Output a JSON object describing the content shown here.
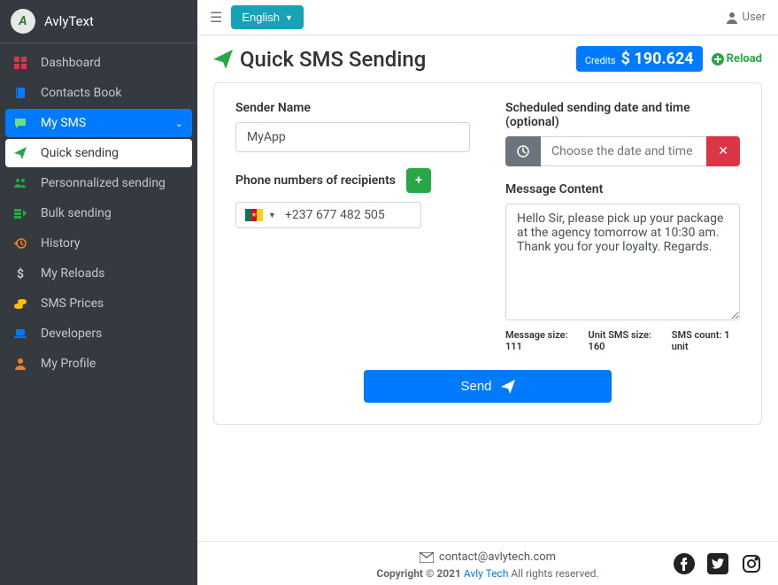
{
  "brand": {
    "name": "AvlyText",
    "logo_letter": "A"
  },
  "topbar": {
    "language": "English",
    "user_label": "User"
  },
  "sidebar": {
    "items": [
      {
        "label": "Dashboard",
        "icon": "grid",
        "color": "#dc3545"
      },
      {
        "label": "Contacts Book",
        "icon": "book",
        "color": "#007bff"
      },
      {
        "label": "My SMS",
        "icon": "comment",
        "color": "#71e07a",
        "active": true,
        "expandable": true
      },
      {
        "label": "Quick sending",
        "icon": "plane",
        "color": "#28a745",
        "sub": true
      },
      {
        "label": "Personnalized sending",
        "icon": "users-cog",
        "color": "#28a745"
      },
      {
        "label": "Bulk sending",
        "icon": "bulk",
        "color": "#28a745"
      },
      {
        "label": "History",
        "icon": "history",
        "color": "#fd7e14"
      },
      {
        "label": "My Reloads",
        "icon": "dollar",
        "color": "#c2c7d0"
      },
      {
        "label": "SMS Prices",
        "icon": "coins",
        "color": "#ffc107"
      },
      {
        "label": "Developers",
        "icon": "laptop",
        "color": "#007bff"
      },
      {
        "label": "My Profile",
        "icon": "user",
        "color": "#fd7e14"
      }
    ]
  },
  "page": {
    "title": "Quick SMS Sending",
    "credits_label": "Credits",
    "credits_amount": "$ 190.624",
    "reload": "Reload"
  },
  "form": {
    "sender_label": "Sender Name",
    "sender_value": "MyApp",
    "recipients_label": "Phone numbers of recipients",
    "phone_value": "+237 677 482 505",
    "date_label": "Scheduled sending date and time (optional)",
    "date_placeholder": "Choose the date and time",
    "content_label": "Message Content",
    "content_value": "Hello Sir, please pick up your package at the agency tomorrow at 10:30 am. Thank you for your loyalty. Regards.",
    "meta": {
      "size_label": "Message size:",
      "size_value": "111",
      "unit_label": "Unit SMS size:",
      "unit_value": "160",
      "count_label": "SMS count:",
      "count_value": "1 unit"
    },
    "send": "Send"
  },
  "footer": {
    "email": "contact@avlytech.com",
    "copy_prefix": "Copyright © 2021 ",
    "company": "Avly Tech",
    "copy_suffix": " All rights reserved."
  }
}
